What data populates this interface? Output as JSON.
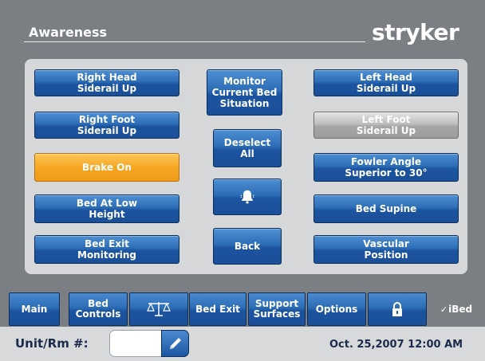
{
  "header": {
    "title": "Awareness",
    "logo": "stryker"
  },
  "buttons": {
    "right_head_siderail": "Right Head\nSiderail Up",
    "right_foot_siderail": "Right Foot\nSiderail Up",
    "brake_on": "Brake On",
    "bed_low_height": "Bed At Low\nHeight",
    "bed_exit_monitoring": "Bed Exit\nMonitoring",
    "monitor_current": "Monitor\nCurrent Bed\nSituation",
    "deselect_all": "Deselect\nAll",
    "alarm_icon": "bell-icon",
    "back": "Back",
    "left_head_siderail": "Left Head\nSiderail Up",
    "left_foot_siderail": "Left Foot\nSiderail Up",
    "fowler_angle": "Fowler Angle\nSuperior to 30°",
    "bed_supine": "Bed Supine",
    "vascular_position": "Vascular\nPosition"
  },
  "tabs": {
    "main": "Main",
    "bed_controls": "Bed\nControls",
    "scale_icon": "scale-icon",
    "bed_exit": "Bed Exit",
    "support_surfaces": "Support\nSurfaces",
    "options": "Options",
    "lock_icon": "lock-icon",
    "ibed": "iBed"
  },
  "footer": {
    "unit_label": "Unit/Rm #:",
    "unit_value": "",
    "edit_icon": "pencil-icon",
    "datetime": "Oct. 25,2007  12:00 AM"
  },
  "colors": {
    "button_blue": "#2c6db6",
    "brake_amber": "#f5a623",
    "inactive_silver": "#bdbdbd",
    "background": "#7b7e82",
    "panel": "#d6d7d9"
  }
}
